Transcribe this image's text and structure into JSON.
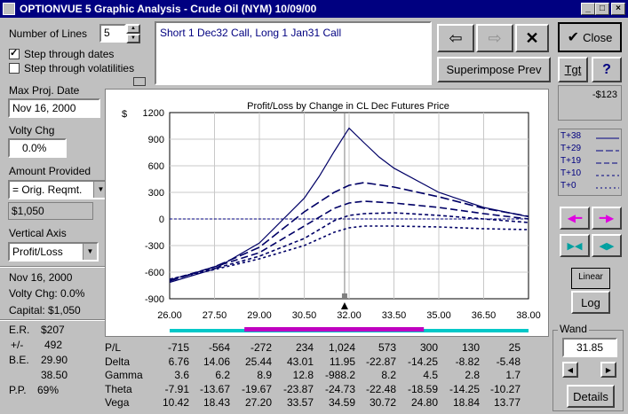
{
  "window": {
    "title": "OPTIONVUE 5 Graphic Analysis - Crude Oil (NYM)  10/09/00"
  },
  "left": {
    "num_lines_label": "Number of Lines",
    "num_lines_value": "5",
    "step_dates_label": "Step through dates",
    "step_vols_label": "Step through volatilities",
    "max_date_label": "Max Proj. Date",
    "max_date_value": "Nov 16, 2000",
    "volty_label": "Volty Chg",
    "volty_value": "0.0%",
    "amount_label": "Amount Provided",
    "amount_select": "= Orig. Reqmt.",
    "amount_value": "$1,050",
    "vaxis_label": "Vertical Axis",
    "vaxis_select": "Profit/Loss",
    "info_date": "Nov 16, 2000",
    "info_volty": "Volty Chg: 0.0%",
    "info_capital": "Capital:  $1,050"
  },
  "stats": {
    "er_label": "E.R.",
    "er_value": "$207",
    "pm_label": "+/-",
    "pm_value": "492",
    "be_label": "B.E.",
    "be_value1": "29.90",
    "be_value2": "38.50",
    "pp_label": "P.P.",
    "pp_value": "69%"
  },
  "strategy": {
    "text": "Short 1 Dec32 Call, Long 1 Jan31 Call"
  },
  "buttons": {
    "close": "Close",
    "superimpose": "Superimpose Prev",
    "tgt": "Tgt",
    "help": "?",
    "linear": "Linear",
    "log": "Log",
    "details": "Details"
  },
  "right": {
    "tgt_value": "-$123",
    "wand_label": "Wand",
    "wand_value": "31.85"
  },
  "legend": [
    {
      "label": "T+38",
      "dash": "none"
    },
    {
      "label": "T+29",
      "dash": "8,3"
    },
    {
      "label": "T+19",
      "dash": "6,3"
    },
    {
      "label": "T+10",
      "dash": "3,3"
    },
    {
      "label": "T+0",
      "dash": "2,3"
    }
  ],
  "chart_data": {
    "type": "line",
    "title": "Profit/Loss by Change in CL Dec Futures Price",
    "ylabel": "$",
    "xlim": [
      26.0,
      38.0
    ],
    "ylim": [
      -900,
      1200
    ],
    "xticks": [
      "26.00",
      "27.50",
      "29.00",
      "30.50",
      "32.00",
      "33.50",
      "35.00",
      "36.50",
      "38.00"
    ],
    "yticks": [
      "1200",
      "900",
      "600",
      "300",
      "0",
      "-300",
      "-600",
      "-900"
    ],
    "yticks_values": [
      1200,
      900,
      600,
      300,
      0,
      -300,
      -600,
      -900
    ],
    "series": [
      {
        "name": "T+38",
        "x": [
          26,
          27.5,
          29,
          30.5,
          31,
          31.5,
          32,
          32.5,
          33,
          33.5,
          35,
          36.5,
          38
        ],
        "values": [
          -715,
          -564,
          -272,
          234,
          480,
          760,
          1024,
          860,
          700,
          573,
          300,
          130,
          25
        ]
      },
      {
        "name": "T+29",
        "x": [
          26,
          27.5,
          29,
          30.5,
          31.5,
          32,
          32.5,
          33.5,
          35,
          36.5,
          38
        ],
        "values": [
          -700,
          -540,
          -320,
          80,
          300,
          380,
          410,
          360,
          250,
          120,
          30
        ]
      },
      {
        "name": "T+19",
        "x": [
          26,
          27.5,
          29,
          30.5,
          31.5,
          32,
          32.5,
          33.5,
          35,
          36.5,
          38
        ],
        "values": [
          -690,
          -540,
          -380,
          -80,
          120,
          180,
          200,
          180,
          130,
          60,
          0
        ]
      },
      {
        "name": "T+10",
        "x": [
          26,
          27.5,
          29,
          30.5,
          31.5,
          32,
          32.5,
          33.5,
          35,
          36.5,
          38
        ],
        "values": [
          -680,
          -560,
          -420,
          -220,
          -20,
          40,
          60,
          70,
          40,
          0,
          -40
        ]
      },
      {
        "name": "T+0",
        "x": [
          26,
          27.5,
          29,
          30.5,
          31.5,
          32,
          32.5,
          33.5,
          35,
          36.5,
          38
        ],
        "values": [
          -680,
          -570,
          -450,
          -300,
          -150,
          -100,
          -80,
          -80,
          -90,
          -110,
          -120
        ]
      }
    ],
    "cursor_x": 31.85,
    "zero_line": true
  },
  "table": {
    "rows": [
      {
        "label": "P/L",
        "values": [
          "-715",
          "-564",
          "-272",
          "234",
          "1,024",
          "573",
          "300",
          "130",
          "25"
        ]
      },
      {
        "label": "Delta",
        "values": [
          "6.76",
          "14.06",
          "25.44",
          "43.01",
          "11.95",
          "-22.87",
          "-14.25",
          "-8.82",
          "-5.48"
        ]
      },
      {
        "label": "Gamma",
        "values": [
          "3.6",
          "6.2",
          "8.9",
          "12.8",
          "-988.2",
          "8.2",
          "4.5",
          "2.8",
          "1.7"
        ]
      },
      {
        "label": "Theta",
        "values": [
          "-7.91",
          "-13.67",
          "-19.67",
          "-23.87",
          "-24.73",
          "-22.48",
          "-18.59",
          "-14.25",
          "-10.27"
        ]
      },
      {
        "label": "Vega",
        "values": [
          "10.42",
          "18.43",
          "27.20",
          "33.57",
          "34.59",
          "30.72",
          "24.80",
          "18.84",
          "13.77"
        ]
      }
    ]
  },
  "colors": {
    "title_bar": "#000080",
    "plot_line": "#000066",
    "cyan_bar": "#00c8c8",
    "magenta_bar": "#c000c0",
    "legend_text": "#000080"
  }
}
